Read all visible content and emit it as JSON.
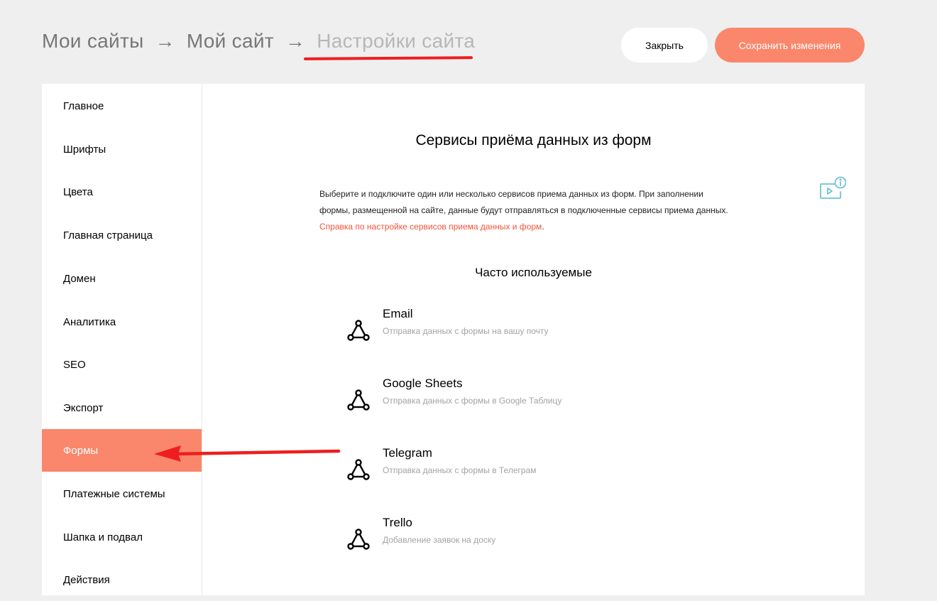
{
  "breadcrumb": {
    "items": [
      "Мои сайты",
      "Мой сайт"
    ],
    "separator": "→",
    "current": "Настройки сайта"
  },
  "toolbar": {
    "close_label": "Закрыть",
    "save_label": "Сохранить изменения"
  },
  "sidebar": {
    "items": [
      {
        "label": "Главное"
      },
      {
        "label": "Шрифты"
      },
      {
        "label": "Цвета"
      },
      {
        "label": "Главная страница"
      },
      {
        "label": "Домен"
      },
      {
        "label": "Аналитика"
      },
      {
        "label": "SEO"
      },
      {
        "label": "Экспорт"
      },
      {
        "label": "Формы",
        "active": true
      },
      {
        "label": "Платежные системы"
      },
      {
        "label": "Шапка и подвал"
      },
      {
        "label": "Действия"
      }
    ]
  },
  "main": {
    "title": "Сервисы приёма данных из форм",
    "description_line1": "Выберите и подключите один или несколько сервисов приема данных из форм. При заполнении",
    "description_line2": "формы, размещенной на сайте, данные будут отправляться в подключенные сервисы приема данных.",
    "help_link": "Справка по настройке сервисов приема данных и форм",
    "help_link_suffix": ".",
    "popular_title": "Часто используемые",
    "services": [
      {
        "name": "Email",
        "description": "Отправка данных с формы на вашу почту",
        "icon": "integration-icon"
      },
      {
        "name": "Google Sheets",
        "description": "Отправка данных с формы в Google Таблицу",
        "icon": "integration-icon"
      },
      {
        "name": "Telegram",
        "description": "Отправка данных с формы в Телеграм",
        "icon": "integration-icon"
      },
      {
        "name": "Trello",
        "description": "Добавление заявок на доску",
        "icon": "integration-icon"
      }
    ]
  },
  "colors": {
    "accent": "#fa876b",
    "link": "#f2533a",
    "annotation": "#ef1e1e",
    "info_icon": "#6fc3d8"
  }
}
